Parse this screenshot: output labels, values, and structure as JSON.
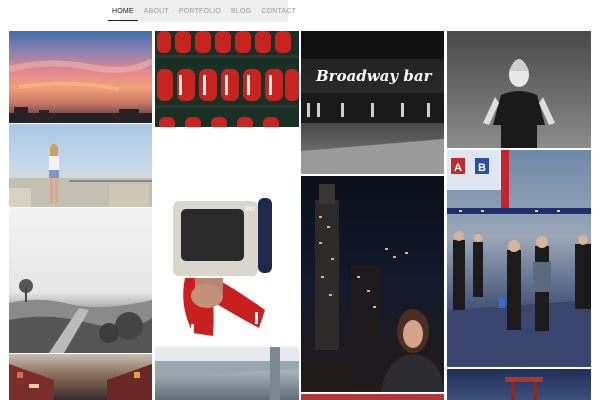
{
  "nav": {
    "items": [
      {
        "label": "HOME",
        "active": true
      },
      {
        "label": "ABOUT",
        "active": false
      },
      {
        "label": "PORTFOLIO",
        "active": false
      },
      {
        "label": "BLOG",
        "active": false
      },
      {
        "label": "CONTACT",
        "active": false
      }
    ]
  },
  "gallery": {
    "broadway_sign_text": "Broadway bar",
    "street_sign_letters": [
      "A",
      "B"
    ]
  },
  "colors": {
    "nav_background": "#efefef",
    "nav_active": "#222222",
    "nav_inactive": "#9a9a9a"
  }
}
